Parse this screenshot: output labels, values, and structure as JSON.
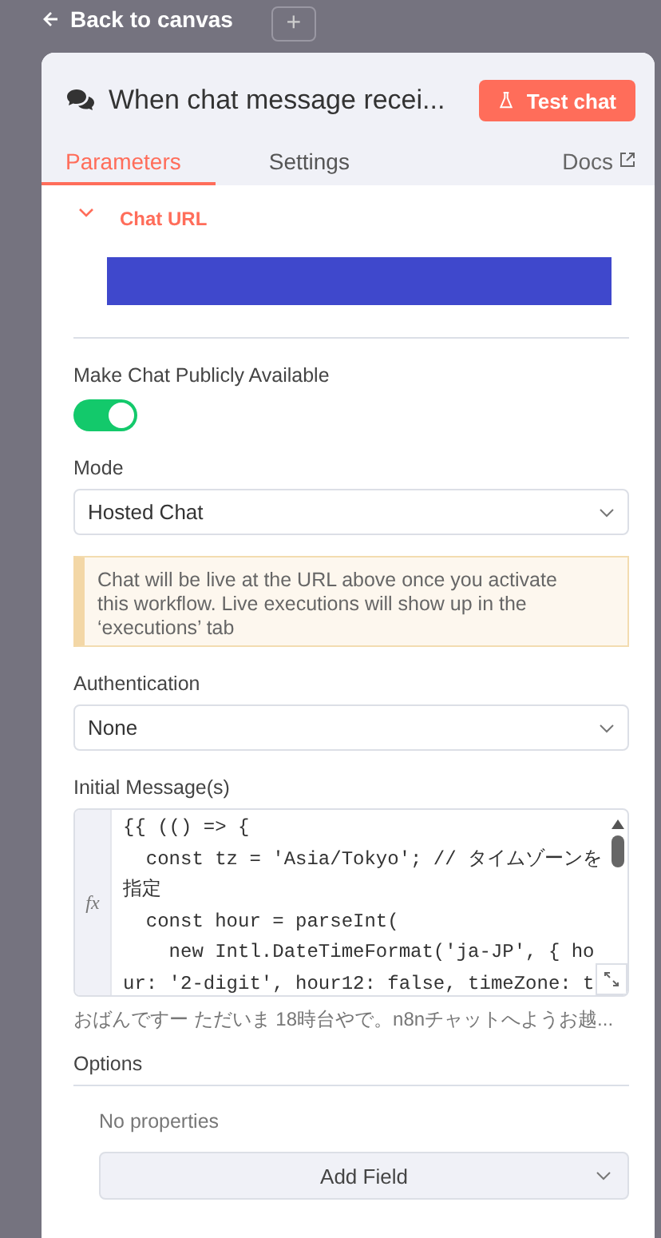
{
  "back_link": {
    "label": "Back to canvas"
  },
  "add_button": {
    "label": "+"
  },
  "panel": {
    "title": "When chat message recei...",
    "test_button": "Test chat"
  },
  "tabs": [
    {
      "label": "Parameters",
      "selected": true
    },
    {
      "label": "Settings",
      "selected": false
    }
  ],
  "docs_link": {
    "label": "Docs"
  },
  "chat_url": {
    "label": "Chat URL",
    "expanded": true
  },
  "public_toggle": {
    "label": "Make Chat Publicly Available",
    "on": true
  },
  "mode": {
    "label": "Mode",
    "value": "Hosted Chat"
  },
  "notice": {
    "text": "Chat will be live at the URL above once you activate this workflow. Live executions will show up in the ‘executions’ tab"
  },
  "authentication": {
    "label": "Authentication",
    "value": "None"
  },
  "initial_messages": {
    "label": "Initial Message(s)",
    "prefix": "fx",
    "code_lines": [
      "{{ (() => {",
      "  const tz = 'Asia/Tokyo'; // タイムゾーンを",
      "指定",
      "  const hour = parseInt(",
      "    new Intl.DateTimeFormat('ja-JP', { ho",
      "ur: '2-digit', hour12: false, timeZone: t"
    ],
    "preview": "おばんですー ただいま 18時台やで。n8nチャットへようお越..."
  },
  "options": {
    "label": "Options",
    "empty_text": "No properties",
    "add_button": "Add Field"
  }
}
